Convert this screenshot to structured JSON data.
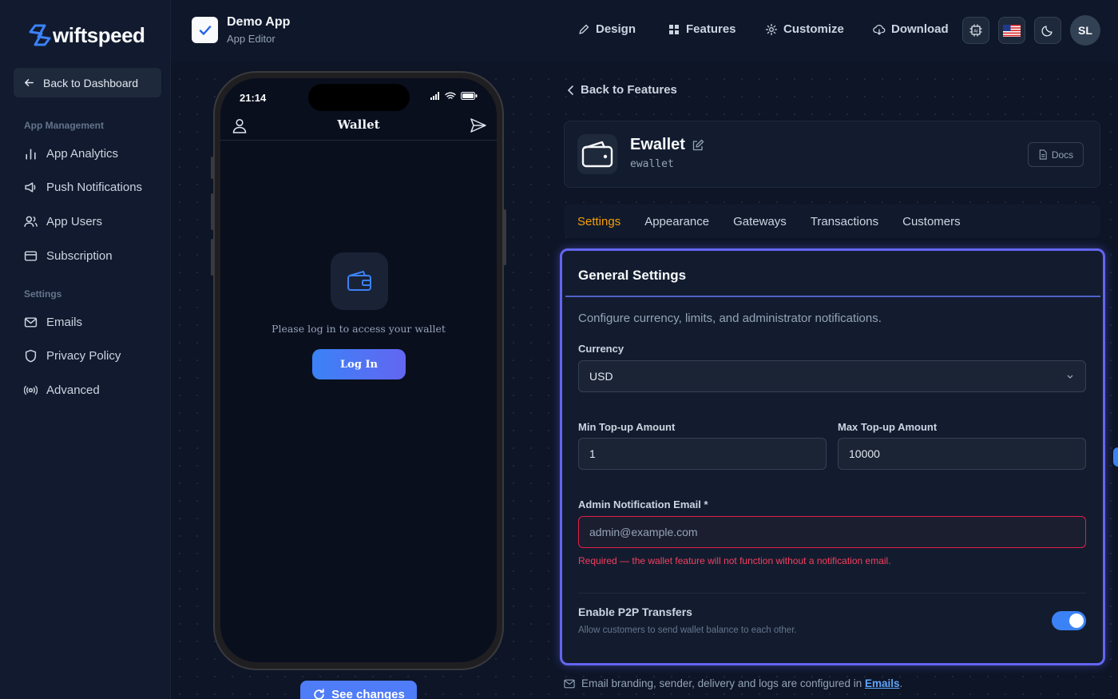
{
  "sidebar": {
    "logo_text": "wiftspeed",
    "back_label": "Back to Dashboard",
    "section_app": "App Management",
    "app_items": [
      {
        "label": "App Analytics",
        "icon": "bar-chart-icon"
      },
      {
        "label": "Push Notifications",
        "icon": "megaphone-icon"
      },
      {
        "label": "App Users",
        "icon": "users-icon"
      },
      {
        "label": "Subscription",
        "icon": "credit-card-icon"
      }
    ],
    "section_settings": "Settings",
    "settings_items": [
      {
        "label": "Emails",
        "icon": "mail-icon"
      },
      {
        "label": "Privacy Policy",
        "icon": "shield-icon"
      },
      {
        "label": "Advanced",
        "icon": "broadcast-icon"
      }
    ]
  },
  "header": {
    "app_name": "Demo App",
    "app_sub": "App Editor",
    "nav": [
      {
        "label": "Design",
        "icon": "pen-icon"
      },
      {
        "label": "Features",
        "icon": "grid-icon"
      },
      {
        "label": "Customize",
        "icon": "gear-icon"
      },
      {
        "label": "Download",
        "icon": "cloud-download-icon"
      }
    ],
    "avatar": "SL"
  },
  "phone": {
    "time": "21:14",
    "title": "Wallet",
    "message": "Please log in to access your wallet",
    "login_label": "Log In"
  },
  "see_changes_label": "See changes",
  "feature": {
    "back_label": "Back to Features",
    "name": "Ewallet",
    "slug": "ewallet",
    "docs_label": "Docs"
  },
  "tabs": [
    {
      "label": "Settings",
      "active": true
    },
    {
      "label": "Appearance",
      "active": false
    },
    {
      "label": "Gateways",
      "active": false
    },
    {
      "label": "Transactions",
      "active": false
    },
    {
      "label": "Customers",
      "active": false
    }
  ],
  "settings": {
    "title": "General Settings",
    "description": "Configure currency, limits, and administrator notifications.",
    "currency_label": "Currency",
    "currency_value": "USD",
    "min_label": "Min Top-up Amount",
    "min_value": "1",
    "max_label": "Max Top-up Amount",
    "max_value": "10000",
    "email_label": "Admin Notification Email *",
    "email_placeholder": "admin@example.com",
    "email_error": "Required — the wallet feature will not function without a notification email.",
    "p2p_label": "Enable P2P Transfers",
    "p2p_desc": "Allow customers to send wallet balance to each other.",
    "p2p_enabled": true
  },
  "footnote": {
    "text": "Email branding, sender, delivery and logs are configured in",
    "link": "Emails",
    "period": "."
  },
  "colors": {
    "accent": "#6366f1",
    "active_tab": "#f59e0b",
    "error": "#f43f5e",
    "toggle_on": "#3b82f6"
  }
}
